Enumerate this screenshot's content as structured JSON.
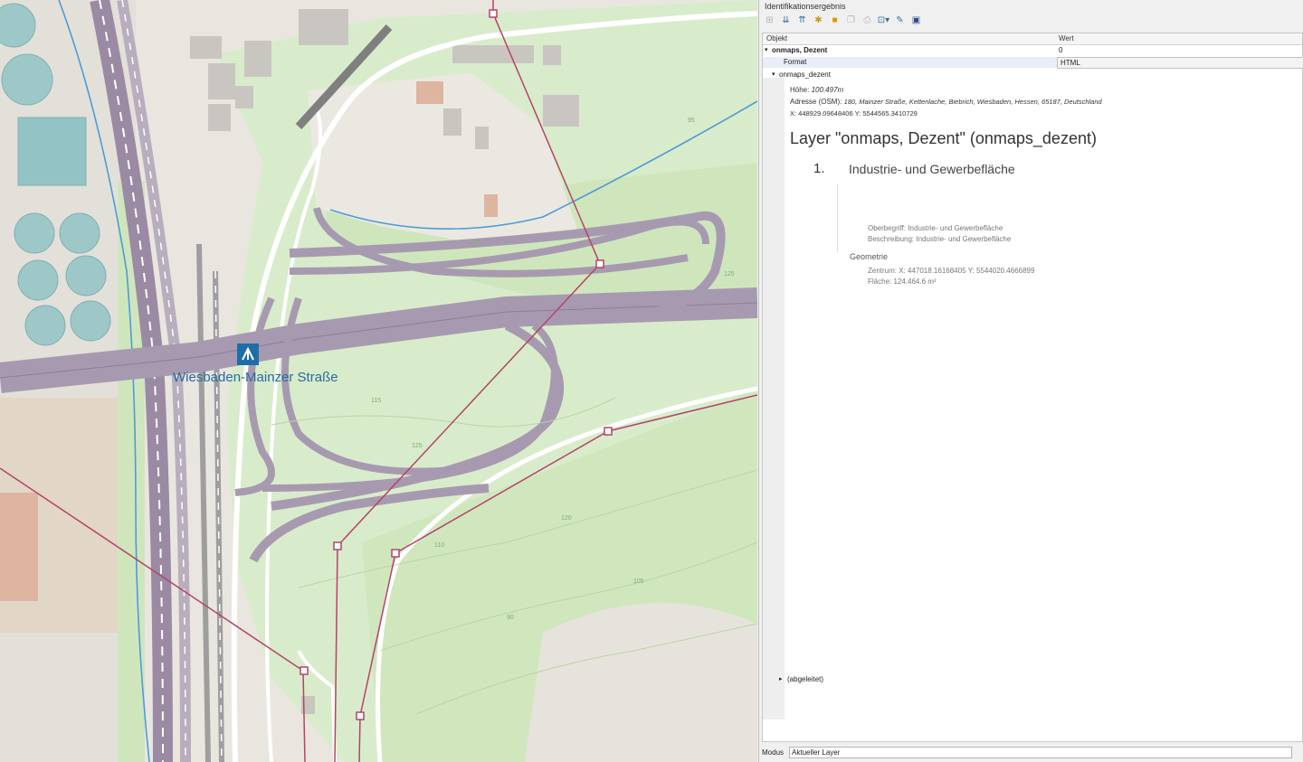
{
  "map": {
    "label_interchange": "Wiesbaden-Mainzer Straße",
    "contours": [
      "125",
      "120",
      "115",
      "110",
      "105",
      "95",
      "90",
      "125",
      "115"
    ],
    "colors": {
      "green": "#d4e8c2",
      "road": "#a79ab0",
      "water": "#8fc3c4",
      "rail": "#9b8aa3",
      "powerline": "#b5436a"
    }
  },
  "panel": {
    "title": "Identifikationsergebnis",
    "toolbar": [
      {
        "icon": "expand-tree-icon",
        "enabled": false
      },
      {
        "icon": "expand-all-icon",
        "enabled": true
      },
      {
        "icon": "collapse-all-icon",
        "enabled": true
      },
      {
        "icon": "expand-new-icon",
        "enabled": true
      },
      {
        "icon": "highlight-icon",
        "enabled": true
      },
      {
        "icon": "copy-icon",
        "enabled": false
      },
      {
        "icon": "print-icon",
        "enabled": false
      },
      {
        "icon": "select-features-icon",
        "enabled": true
      },
      {
        "icon": "identify-mode-icon",
        "enabled": true
      },
      {
        "icon": "help-icon",
        "enabled": true
      }
    ],
    "header": {
      "col1": "Objekt",
      "col2": "Wert"
    },
    "row_layer": {
      "name": "onmaps, Dezent",
      "value": "0"
    },
    "row_format": {
      "label": "Format",
      "value": "HTML"
    },
    "row_group": {
      "name": "onmaps_dezent"
    },
    "info": {
      "hoehe_label": "Höhe:",
      "hoehe": "100.497m",
      "adresse_label": "Adresse (OSM):",
      "adresse": "180, Mainzer Straße, Kettenlache, Biebrich, Wiesbaden, Hessen, 65187, Deutschland",
      "xy": "X: 448929.09648406   Y: 5544565.3410729",
      "layer_heading": "Layer \"onmaps, Dezent\" (onmaps_dezent)",
      "item_number": "1.",
      "item_title": "Industrie- und Gewerbefläche",
      "oberbegriff": "Oberbegriff: Industrie- und Gewerbefläche",
      "beschreibung": "Beschreibung: Industrie- und Gewerbefläche",
      "geometrie": "Geometrie",
      "zentrum": "Zentrum: X: 447018.16168405   Y: 5544020.4666899",
      "flaeche": "Fläche: 124.464.6 m²"
    },
    "row_derived": {
      "label": "(abgeleitet)"
    },
    "status": {
      "mode_label": "Modus",
      "mode_value": "Aktueller Layer"
    }
  }
}
